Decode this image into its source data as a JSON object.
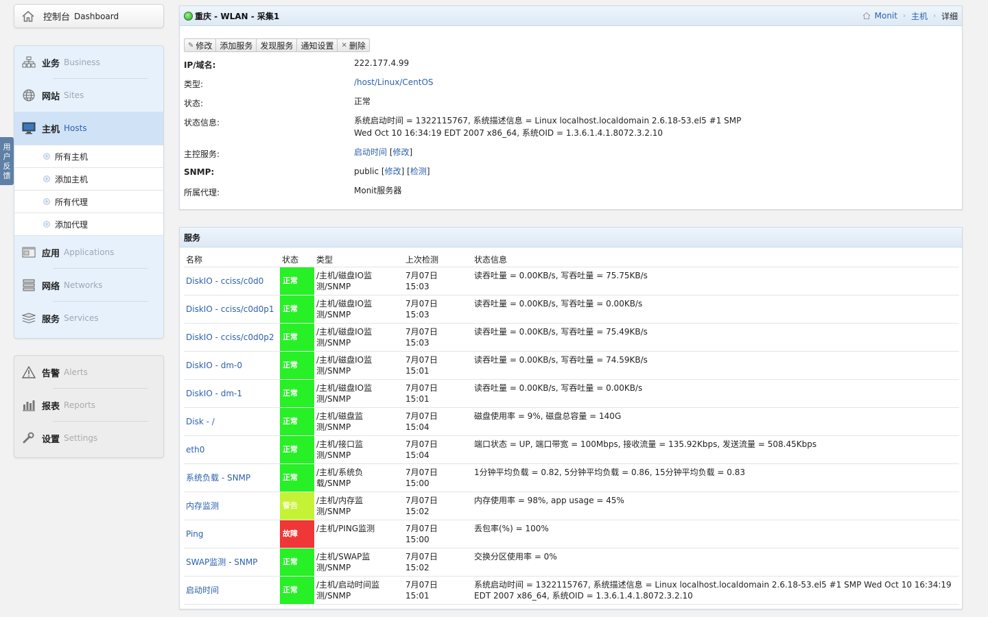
{
  "sidebar": {
    "dashboard": {
      "zh": "控制台",
      "en": "Dashboard"
    },
    "nav_main": [
      {
        "zh": "业务",
        "en": "Business",
        "icon": "sitemap-icon"
      },
      {
        "zh": "网站",
        "en": "Sites",
        "icon": "globe-icon"
      },
      {
        "zh": "主机",
        "en": "Hosts",
        "icon": "monitor-icon",
        "active": true
      },
      {
        "zh": "应用",
        "en": "Applications",
        "icon": "window-icon"
      },
      {
        "zh": "网络",
        "en": "Networks",
        "icon": "server-icon"
      },
      {
        "zh": "服务",
        "en": "Services",
        "icon": "stack-icon"
      }
    ],
    "hosts_sub": [
      "所有主机",
      "添加主机",
      "所有代理",
      "添加代理"
    ],
    "nav_secondary": [
      {
        "zh": "告警",
        "en": "Alerts",
        "icon": "warning-icon"
      },
      {
        "zh": "报表",
        "en": "Reports",
        "icon": "bar-chart-icon"
      },
      {
        "zh": "设置",
        "en": "Settings",
        "icon": "wrench-icon"
      }
    ],
    "feedback": [
      "用",
      "户",
      "反",
      "馈"
    ]
  },
  "host": {
    "title": "重庆 - WLAN - 采集1",
    "status_color": "#2aa52a",
    "breadcrumb": [
      "Monit",
      "主机",
      "详细"
    ],
    "toolbar": [
      "修改",
      "添加服务",
      "发现服务",
      "通知设置",
      "删除"
    ],
    "info": {
      "ip_label": "IP/域名:",
      "ip": "222.177.4.99",
      "type_label": "类型:",
      "type_value": "/host/Linux/CentOS",
      "status_label": "状态:",
      "status_value": "正常",
      "status_info_label": "状态信息:",
      "status_info": "系统启动时间 = 1322115767, 系统描述信息 = Linux localhost.localdomain 2.6.18-53.el5 #1 SMP Wed Oct 10 16:34:19 EDT 2007 x86_64, 系统OID = 1.3.6.1.4.1.8072.3.2.10",
      "master_label": "主控服务:",
      "master_value": "启动时间",
      "master_edit": "修改",
      "snmp_label": "SNMP:",
      "snmp_value": "public",
      "snmp_edit": "修改",
      "snmp_test": "检测",
      "proxy_label": "所属代理:",
      "proxy_value": "Monit服务器"
    }
  },
  "services": {
    "title": "服务",
    "columns": [
      "名称",
      "状态",
      "类型",
      "上次检测",
      "状态信息"
    ],
    "rows": [
      {
        "name": "DiskIO - cciss/c0d0",
        "status": "正常",
        "level": "ok",
        "type": "/主机/磁盘IO监测/SNMP",
        "date": "7月07日",
        "time": "15:03",
        "info": "读吞吐量 = 0.00KB/s, 写吞吐量 = 75.75KB/s"
      },
      {
        "name": "DiskIO - cciss/c0d0p1",
        "status": "正常",
        "level": "ok",
        "type": "/主机/磁盘IO监测/SNMP",
        "date": "7月07日",
        "time": "15:03",
        "info": "读吞吐量 = 0.00KB/s, 写吞吐量 = 0.00KB/s"
      },
      {
        "name": "DiskIO - cciss/c0d0p2",
        "status": "正常",
        "level": "ok",
        "type": "/主机/磁盘IO监测/SNMP",
        "date": "7月07日",
        "time": "15:03",
        "info": "读吞吐量 = 0.00KB/s, 写吞吐量 = 75.49KB/s"
      },
      {
        "name": "DiskIO - dm-0",
        "status": "正常",
        "level": "ok",
        "type": "/主机/磁盘IO监测/SNMP",
        "date": "7月07日",
        "time": "15:01",
        "info": "读吞吐量 = 0.00KB/s, 写吞吐量 = 74.59KB/s"
      },
      {
        "name": "DiskIO - dm-1",
        "status": "正常",
        "level": "ok",
        "type": "/主机/磁盘IO监测/SNMP",
        "date": "7月07日",
        "time": "15:01",
        "info": "读吞吐量 = 0.00KB/s, 写吞吐量 = 0.00KB/s"
      },
      {
        "name": "Disk - /",
        "status": "正常",
        "level": "ok",
        "type": "/主机/磁盘监测/SNMP",
        "date": "7月07日",
        "time": "15:04",
        "info": "磁盘使用率 = 9%, 磁盘总容量 = 140G"
      },
      {
        "name": "eth0",
        "status": "正常",
        "level": "ok",
        "type": "/主机/接口监测/SNMP",
        "date": "7月07日",
        "time": "15:04",
        "info": "端口状态 = UP, 端口带宽 = 100Mbps, 接收流量 = 135.92Kbps, 发送流量 = 508.45Kbps"
      },
      {
        "name": "系统负载 - SNMP",
        "status": "正常",
        "level": "ok",
        "type": "/主机/系统负载/SNMP",
        "date": "7月07日",
        "time": "15:00",
        "info": "1分钟平均负载 = 0.82, 5分钟平均负载 = 0.86, 15分钟平均负载 = 0.83"
      },
      {
        "name": "内存监测",
        "status": "警告",
        "level": "warn",
        "type": "/主机/内存监测/SNMP",
        "date": "7月07日",
        "time": "15:02",
        "info": "内存使用率 = 98%, app usage = 45%"
      },
      {
        "name": "Ping",
        "status": "故障",
        "level": "err",
        "type": "/主机/PING监测",
        "date": "7月07日",
        "time": "15:00",
        "info": "丢包率(%) = 100%"
      },
      {
        "name": "SWAP监测 - SNMP",
        "status": "正常",
        "level": "ok",
        "type": "/主机/SWAP监测/SNMP",
        "date": "7月07日",
        "time": "15:02",
        "info": "交换分区使用率 = 0%"
      },
      {
        "name": "启动时间",
        "status": "正常",
        "level": "ok",
        "type": "/主机/启动时间监测/SNMP",
        "date": "7月07日",
        "time": "15:01",
        "info": "系统启动时间 = 1322115767, 系统描述信息 = Linux localhost.localdomain 2.6.18-53.el5 #1 SMP Wed Oct 10 16:34:19 EDT 2007 x86_64, 系统OID = 1.3.6.1.4.1.8072.3.2.10"
      }
    ]
  }
}
